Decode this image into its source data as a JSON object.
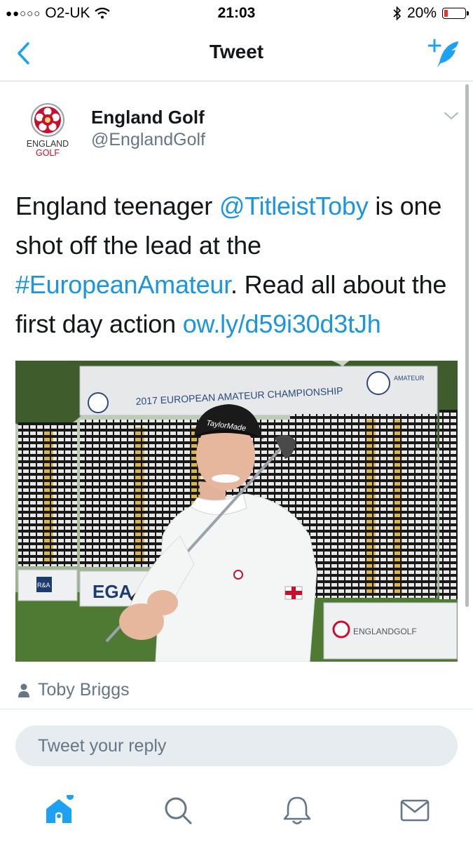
{
  "status_bar": {
    "signal": "●●○○○",
    "carrier": "O2-UK",
    "time": "21:03",
    "battery_percent": "20%",
    "battery_level": 0.2
  },
  "nav": {
    "title": "Tweet",
    "back_icon": "chevron-left-icon",
    "compose_icon": "compose-tweet-icon"
  },
  "tweet": {
    "author_name": "England Golf",
    "author_handle": "@EnglandGolf",
    "avatar_text_line1": "ENGLAND",
    "avatar_text_line2": "GOLF",
    "text_part1": "England teenager ",
    "mention": "@TitleistToby",
    "text_part2": " is one shot off the lead at the ",
    "hashtag": "#EuropeanAmateur",
    "text_part3": ". Read all about the first day action ",
    "url": "ow.ly/d59i30d3tJh",
    "photo": {
      "board_title": "2017 EUROPEAN AMATEUR CHAMPIONSHIP",
      "board_logo_text": "AMATEUR",
      "cap_brand": "TaylorMade",
      "sign_ra": "R&A",
      "sign_ega": "EGA",
      "sign_england_golf": "ENGLANDGOLF"
    },
    "tagged_person": "Toby Briggs"
  },
  "reply": {
    "placeholder": "Tweet your reply"
  },
  "tab_bar": {
    "items": [
      "home-icon",
      "search-icon",
      "notifications-icon",
      "messages-icon"
    ]
  },
  "colors": {
    "link": "#1b95e0",
    "accent": "#1da1f2",
    "battery_low": "#f0312d",
    "brand_red": "#c8102e"
  }
}
